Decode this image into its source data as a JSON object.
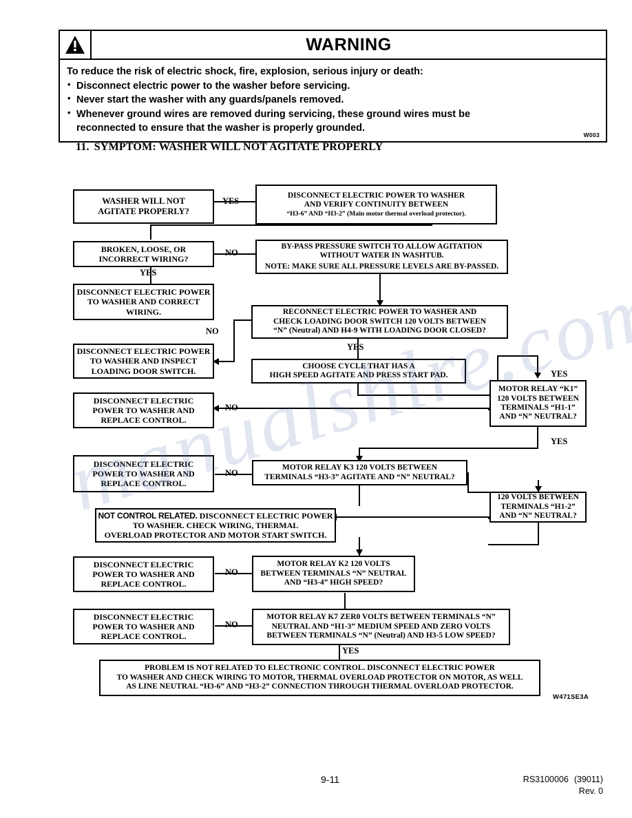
{
  "warning": {
    "symbol": "warning-triangle-icon",
    "title": "WARNING",
    "intro": "To reduce the risk of electric shock, fire, explosion, serious injury or death:",
    "bullets": [
      "Disconnect electric power to the washer before servicing.",
      "Never start the washer with any guards/panels removed.",
      "Whenever ground wires are removed during servicing, these ground wires must be"
    ],
    "bullet3_cont": "reconnected to ensure that the washer is properly grounded.",
    "code": "W003"
  },
  "section": {
    "number": "11.",
    "title": "SYMPTOM: WASHER WILL NOT AGITATE PROPERLY"
  },
  "flowchart": {
    "diagram_code": "W471SE3A",
    "boxes": {
      "start": {
        "lines": [
          "WASHER WILL NOT",
          "AGITATE PROPERLY?"
        ]
      },
      "verify_continuity": {
        "lines": [
          "DISCONNECT ELECTRIC POWER TO WASHER",
          "AND VERIFY CONTINUITY BETWEEN",
          "“H3-6” AND “H3-2” (Main motor thermal overload protector)."
        ]
      },
      "wiring_question": {
        "lines": [
          "BROKEN, LOOSE, OR",
          "INCORRECT WIRING?"
        ]
      },
      "bypass_pressure": {
        "lines": [
          "BY-PASS PRESSURE SWITCH TO ALLOW AGITATION",
          "WITHOUT WATER IN WASHTUB."
        ],
        "note": "NOTE: MAKE SURE ALL PRESSURE LEVELS ARE BY-PASSED."
      },
      "correct_wiring": {
        "lines": [
          "DISCONNECT ELECTRIC POWER",
          "TO WASHER AND CORRECT",
          "WIRING."
        ]
      },
      "reconnect_door": {
        "lines": [
          "RECONNECT ELECTRIC POWER TO WASHER AND",
          "CHECK LOADING DOOR SWITCH 120 VOLTS BETWEEN",
          "“N” (Neutral) AND H4-9 WITH LOADING DOOR CLOSED?"
        ]
      },
      "inspect_door_switch": {
        "lines": [
          "DISCONNECT ELECTRIC POWER",
          "TO WASHER AND INSPECT",
          "LOADING DOOR SWITCH."
        ]
      },
      "choose_cycle": {
        "lines": [
          "CHOOSE CYCLE THAT HAS A",
          "HIGH SPEED AGITATE AND PRESS START PAD."
        ]
      },
      "replace_control_1": {
        "lines": [
          "DISCONNECT ELECTRIC",
          "POWER TO WASHER AND",
          "REPLACE CONTROL."
        ]
      },
      "relay_k1": {
        "lines": [
          "MOTOR RELAY “K1”",
          "120 VOLTS BETWEEN",
          "TERMINALS “H1-1”",
          "AND “N” NEUTRAL?"
        ]
      },
      "replace_control_2": {
        "lines": [
          "DISCONNECT ELECTRIC",
          "POWER TO WASHER AND",
          "REPLACE CONTROL."
        ]
      },
      "relay_k3": {
        "lines": [
          "MOTOR RELAY K3 120 VOLTS BETWEEN",
          "TERMINALS “H3-3” AGITATE AND “N” NEUTRAL?"
        ]
      },
      "terminals_h1_2": {
        "lines": [
          "120 VOLTS BETWEEN",
          "TERMINALS “H1-2”",
          "AND “N” NEUTRAL?"
        ]
      },
      "not_control_related": {
        "lead": "NOT CONTROL RELATED.",
        "lines": [
          " DISCONNECT ELECTRIC POWER",
          "TO WASHER. CHECK WIRING, THERMAL",
          "OVERLOAD PROTECTOR AND MOTOR START SWITCH."
        ]
      },
      "replace_control_3": {
        "lines": [
          "DISCONNECT ELECTRIC",
          "POWER TO WASHER AND",
          "REPLACE CONTROL."
        ]
      },
      "relay_k2": {
        "lines": [
          "MOTOR RELAY K2 120 VOLTS",
          "BETWEEN TERMINALS “N” NEUTRAL",
          "AND “H3-4” HIGH SPEED?"
        ]
      },
      "replace_control_4": {
        "lines": [
          "DISCONNECT ELECTRIC",
          "POWER TO WASHER AND",
          "REPLACE CONTROL."
        ]
      },
      "relay_k7": {
        "lines": [
          "MOTOR RELAY K7 ZER0 VOLTS BETWEEN TERMINALS “N”",
          "NEUTRAL AND “H1-3” MEDIUM SPEED AND ZERO VOLTS",
          "BETWEEN TERMINALS “N” (Neutral) AND H3-5 LOW SPEED?"
        ]
      },
      "final_conclusion": {
        "lines": [
          "PROBLEM IS NOT RELATED TO ELECTRONIC CONTROL. DISCONNECT ELECTRIC POWER",
          "TO WASHER AND CHECK WIRING TO MOTOR, THERMAL OVERLOAD PROTECTOR ON MOTOR, AS WELL",
          "AS LINE NEUTRAL “H3-6” AND “H3-2” CONNECTION THROUGH THERMAL OVERLOAD PROTECTOR."
        ]
      }
    },
    "labels": {
      "yes_start": "YES",
      "no_wiring": "NO",
      "yes_wiring": "YES",
      "no_door": "NO",
      "yes_door": "YES",
      "yes_k1_in": "YES",
      "no_k1": "NO",
      "yes_k1_out": "YES",
      "no_k3": "NO",
      "no_k2": "NO",
      "no_k7": "NO",
      "yes_k7": "YES"
    }
  },
  "footer": {
    "page_number": "9-11",
    "doc_id": "RS3100006",
    "doc_rev_code": "(39011)",
    "revision": "Rev. 0"
  },
  "watermark": {
    "text": "manualshlre.com"
  }
}
